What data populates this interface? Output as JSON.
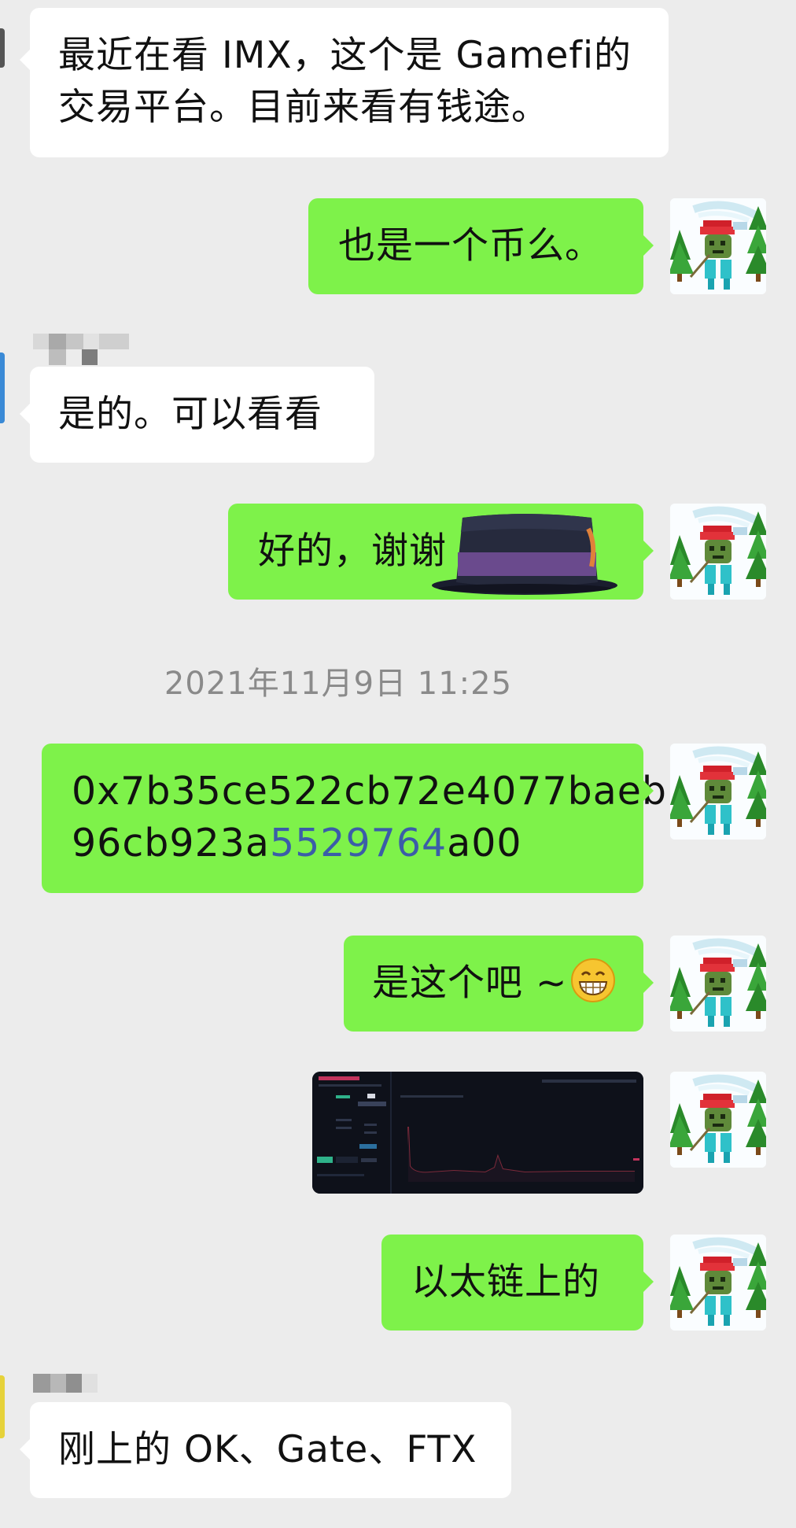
{
  "messages": {
    "m1_line1": "最近在看 IMX，这个是 Gamefi的",
    "m1_line2": "交易平台。目前来看有钱途。",
    "m2": "也是一个币么。",
    "m3": "是的。可以看看",
    "m4": "好的，谢谢",
    "timestamp": "2021年11月9日 11:25",
    "m5_line1": "0x7b35ce522cb72e4077baeb",
    "m5_line2_a": "96cb923a",
    "m5_line2_link": "5529764",
    "m5_line2_b": "a00",
    "m6": "是这个吧 ~",
    "m8": "以太链上的",
    "m9": "刚上的 OK、Gate、FTX"
  },
  "icons": {
    "avatar": "pixel-skier-avatar",
    "hat": "top-hat-sticker",
    "emoji": "grinning-face-emoji",
    "image": "chart-screenshot-thumbnail"
  },
  "colors": {
    "background": "#ececec",
    "self_bubble": "#7ef24a",
    "other_bubble": "#ffffff",
    "timestamp": "#8a8a8a",
    "link": "#3b5da8"
  }
}
